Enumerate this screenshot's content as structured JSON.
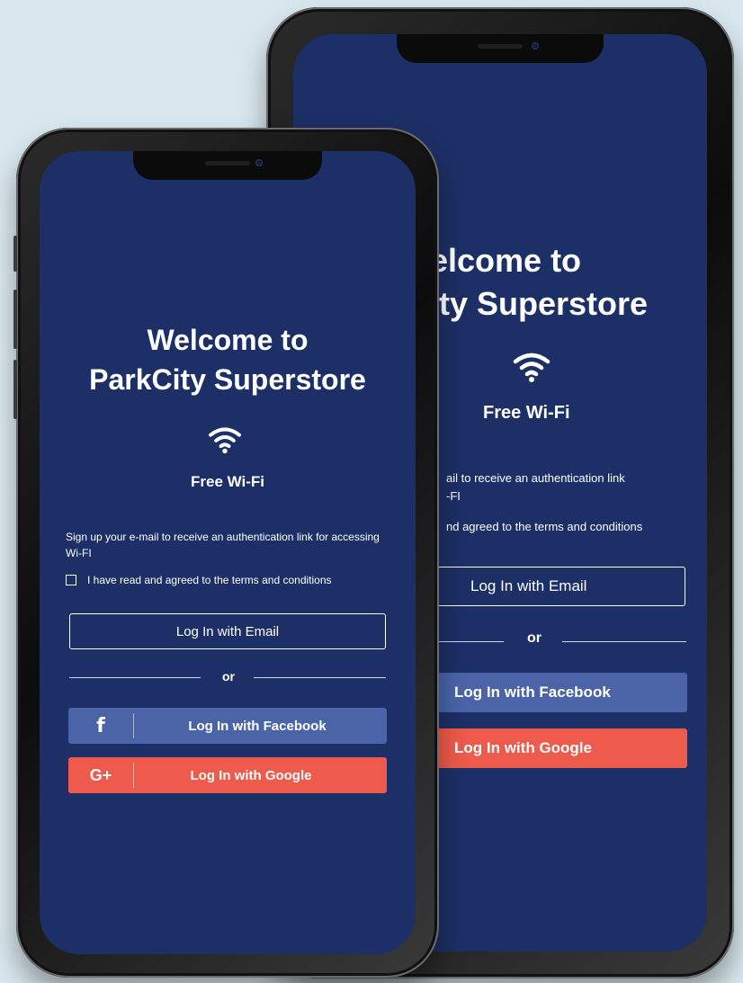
{
  "welcome_line1": "Welcome to",
  "welcome_line2": "ParkCity Superstore",
  "welcome_line1_partial": "elcome to",
  "welcome_line2_partial": "ity Superstore",
  "wifi_label": "Free Wi-Fi",
  "signup_text": "Sign up your e-mail to receive an authentication link for accessing Wi-FI",
  "signup_partial_line1": "ail to receive an authentication link",
  "signup_partial_line2": "-FI",
  "terms_text": "I have read and agreed to the terms and conditions",
  "terms_partial": "nd agreed to the terms and conditions",
  "email_button": "Log In with Email",
  "or_text": "or",
  "facebook_button": "Log In with Facebook",
  "facebook_icon": "f",
  "google_button": "Log In with Google",
  "google_icon": "G+",
  "colors": {
    "screen_bg": "#1c2f66",
    "facebook": "#4a64a7",
    "google": "#ee5a4b",
    "page_bg": "#d9e8ef"
  },
  "icons": [
    "wifi-icon",
    "facebook-icon",
    "google-plus-icon",
    "checkbox-icon"
  ]
}
